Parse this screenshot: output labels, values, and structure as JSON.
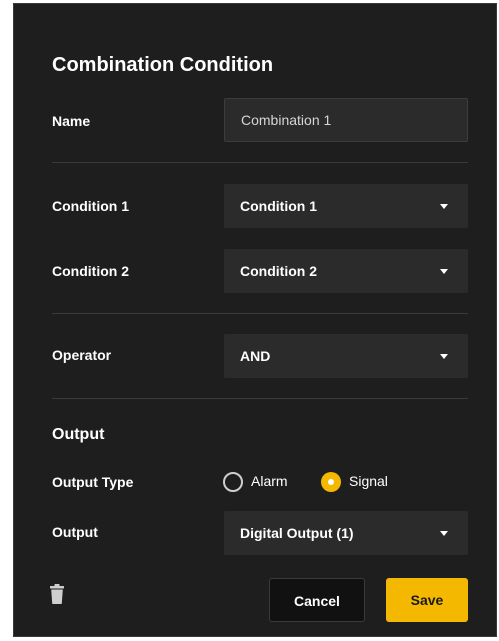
{
  "dialog": {
    "title": "Combination Condition",
    "name_label": "Name",
    "name_value": "Combination 1",
    "condition1_label": "Condition 1",
    "condition1_value": "Condition 1",
    "condition2_label": "Condition 2",
    "condition2_value": "Condition 2",
    "operator_label": "Operator",
    "operator_value": "AND"
  },
  "output": {
    "section_title": "Output",
    "type_label": "Output Type",
    "type_options": [
      "Alarm",
      "Signal"
    ],
    "type_selected": "Signal",
    "output_label": "Output",
    "output_value": "Digital Output (1)"
  },
  "actions": {
    "delete_icon": "trash-icon",
    "cancel_label": "Cancel",
    "save_label": "Save"
  },
  "colors": {
    "accent": "#f5b800",
    "panel_bg": "#1e1e1e",
    "field_bg": "#2b2b2b"
  }
}
